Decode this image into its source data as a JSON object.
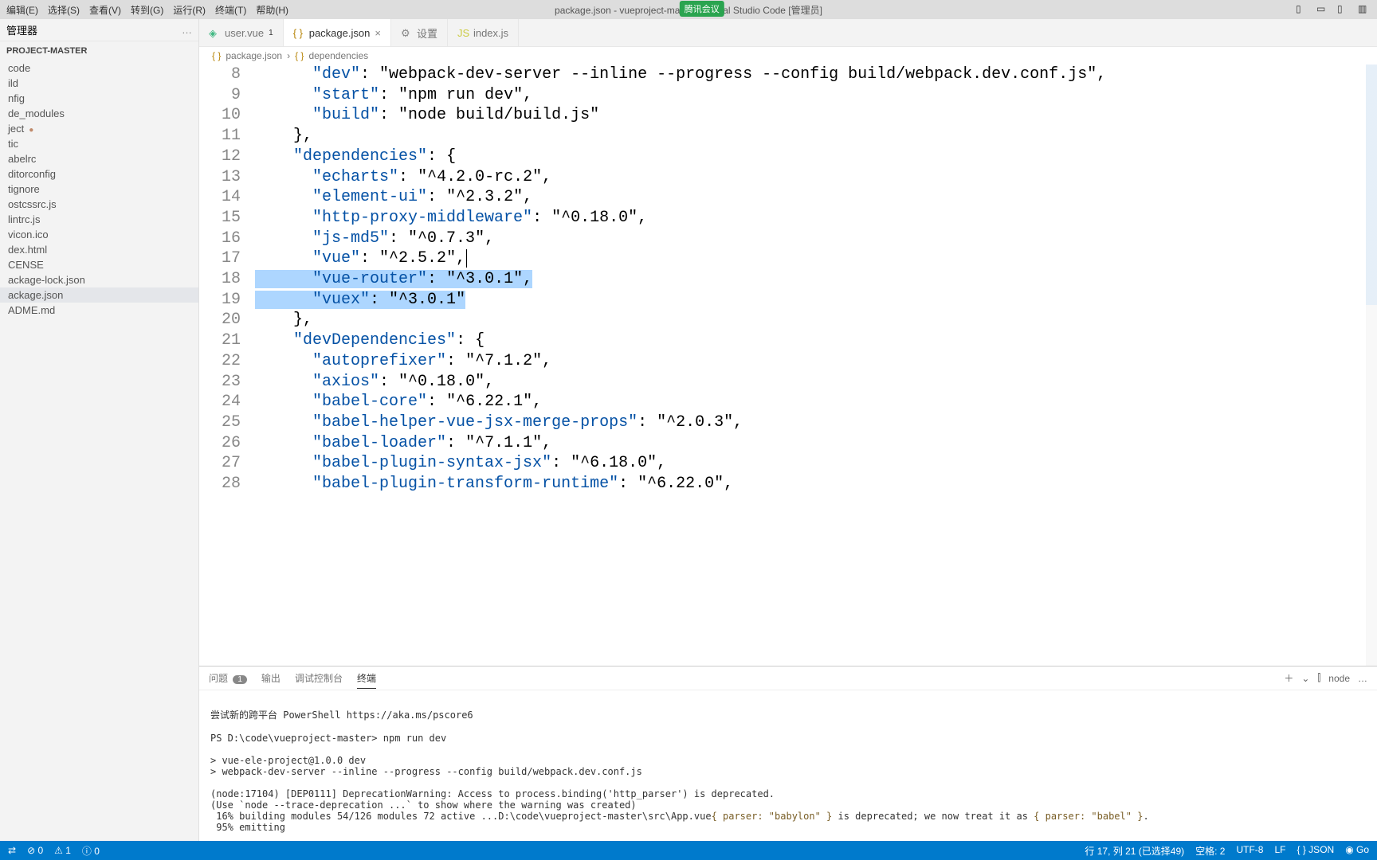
{
  "window": {
    "title": "package.json - vueproject-master - Visual Studio Code [管理员]",
    "meeting_badge": "腾讯会议"
  },
  "menu": [
    "编辑(E)",
    "选择(S)",
    "查看(V)",
    "转到(G)",
    "运行(R)",
    "终端(T)",
    "帮助(H)"
  ],
  "sidebar": {
    "header": "管理器",
    "project": "PROJECT-MASTER",
    "items": [
      {
        "label": "code"
      },
      {
        "label": "ild"
      },
      {
        "label": "nfig"
      },
      {
        "label": "de_modules"
      },
      {
        "label": "ject",
        "dirty": true
      },
      {
        "label": "tic"
      },
      {
        "label": "abelrc"
      },
      {
        "label": "ditorconfig"
      },
      {
        "label": "tignore"
      },
      {
        "label": "ostcssrc.js"
      },
      {
        "label": "lintrc.js"
      },
      {
        "label": "vicon.ico"
      },
      {
        "label": "dex.html"
      },
      {
        "label": "CENSE"
      },
      {
        "label": "ackage-lock.json"
      },
      {
        "label": "ackage.json",
        "active": true
      },
      {
        "label": "ADME.md"
      }
    ]
  },
  "tabs": [
    {
      "label": "user.vue",
      "icon": "vue",
      "dirty": "1"
    },
    {
      "label": "package.json",
      "icon": "json",
      "active": true,
      "close": "×"
    },
    {
      "label": "设置",
      "icon": "gear"
    },
    {
      "label": "index.js",
      "icon": "js"
    }
  ],
  "breadcrumb": {
    "file": "package.json",
    "path": "dependencies"
  },
  "editor": {
    "first_line": 8,
    "lines": [
      {
        "n": 8,
        "txt": "      \"dev\": \"webpack-dev-server --inline --progress --config build/webpack.dev.conf.js\","
      },
      {
        "n": 9,
        "txt": "      \"start\": \"npm run dev\","
      },
      {
        "n": 10,
        "txt": "      \"build\": \"node build/build.js\""
      },
      {
        "n": 11,
        "txt": "    },"
      },
      {
        "n": 12,
        "txt": "    \"dependencies\": {"
      },
      {
        "n": 13,
        "txt": "      \"echarts\": \"^4.2.0-rc.2\","
      },
      {
        "n": 14,
        "txt": "      \"element-ui\": \"^2.3.2\","
      },
      {
        "n": 15,
        "txt": "      \"http-proxy-middleware\": \"^0.18.0\","
      },
      {
        "n": 16,
        "txt": "      \"js-md5\": \"^0.7.3\","
      },
      {
        "n": 17,
        "txt": "      \"vue\": \"^2.5.2\",",
        "caret_after": true
      },
      {
        "n": 18,
        "txt": "      \"vue-router\": \"^3.0.1\",",
        "sel": true
      },
      {
        "n": 19,
        "txt": "      \"vuex\": \"^3.0.1\"",
        "sel": true
      },
      {
        "n": 20,
        "txt": "    },"
      },
      {
        "n": 21,
        "txt": "    \"devDependencies\": {"
      },
      {
        "n": 22,
        "txt": "      \"autoprefixer\": \"^7.1.2\","
      },
      {
        "n": 23,
        "txt": "      \"axios\": \"^0.18.0\","
      },
      {
        "n": 24,
        "txt": "      \"babel-core\": \"^6.22.1\","
      },
      {
        "n": 25,
        "txt": "      \"babel-helper-vue-jsx-merge-props\": \"^2.0.3\","
      },
      {
        "n": 26,
        "txt": "      \"babel-loader\": \"^7.1.1\","
      },
      {
        "n": 27,
        "txt": "      \"babel-plugin-syntax-jsx\": \"^6.18.0\","
      },
      {
        "n": 28,
        "txt": "      \"babel-plugin-transform-runtime\": \"^6.22.0\","
      }
    ]
  },
  "panel": {
    "tabs": {
      "problems": "问题",
      "problems_count": "1",
      "output": "输出",
      "debug": "调试控制台",
      "terminal": "终端"
    },
    "right": {
      "plus": "＋",
      "split": "⫿",
      "shell": "node",
      "more": "…"
    },
    "terminal": {
      "line1": "尝试新的跨平台 PowerShell https://aka.ms/pscore6",
      "line2": "PS D:\\code\\vueproject-master> npm run dev",
      "line3": "> vue-ele-project@1.0.0 dev",
      "line4": "> webpack-dev-server --inline --progress --config build/webpack.dev.conf.js",
      "line5": "(node:17104) [DEP0111] DeprecationWarning: Access to process.binding('http_parser') is deprecated.",
      "line6": "(Use `node --trace-deprecation ...` to show where the warning was created)",
      "line7_a": " 16% building modules 54/126 modules 72 active ...D:\\code\\vueproject-master\\src\\App.vue",
      "line7_b": "{ parser: \"babylon\" }",
      "line7_c": " is deprecated; we now treat it as ",
      "line7_d": "{ parser: \"babel\" }",
      "line7_e": ".",
      "line8": " 95% emitting"
    }
  },
  "status": {
    "left": [
      "⊘ 0",
      "⚠ 1",
      "ⓘ 0"
    ],
    "right": [
      "行 17, 列 21 (已选择49)",
      "空格: 2",
      "UTF-8",
      "LF",
      "{ } JSON",
      "◉ Go"
    ]
  }
}
